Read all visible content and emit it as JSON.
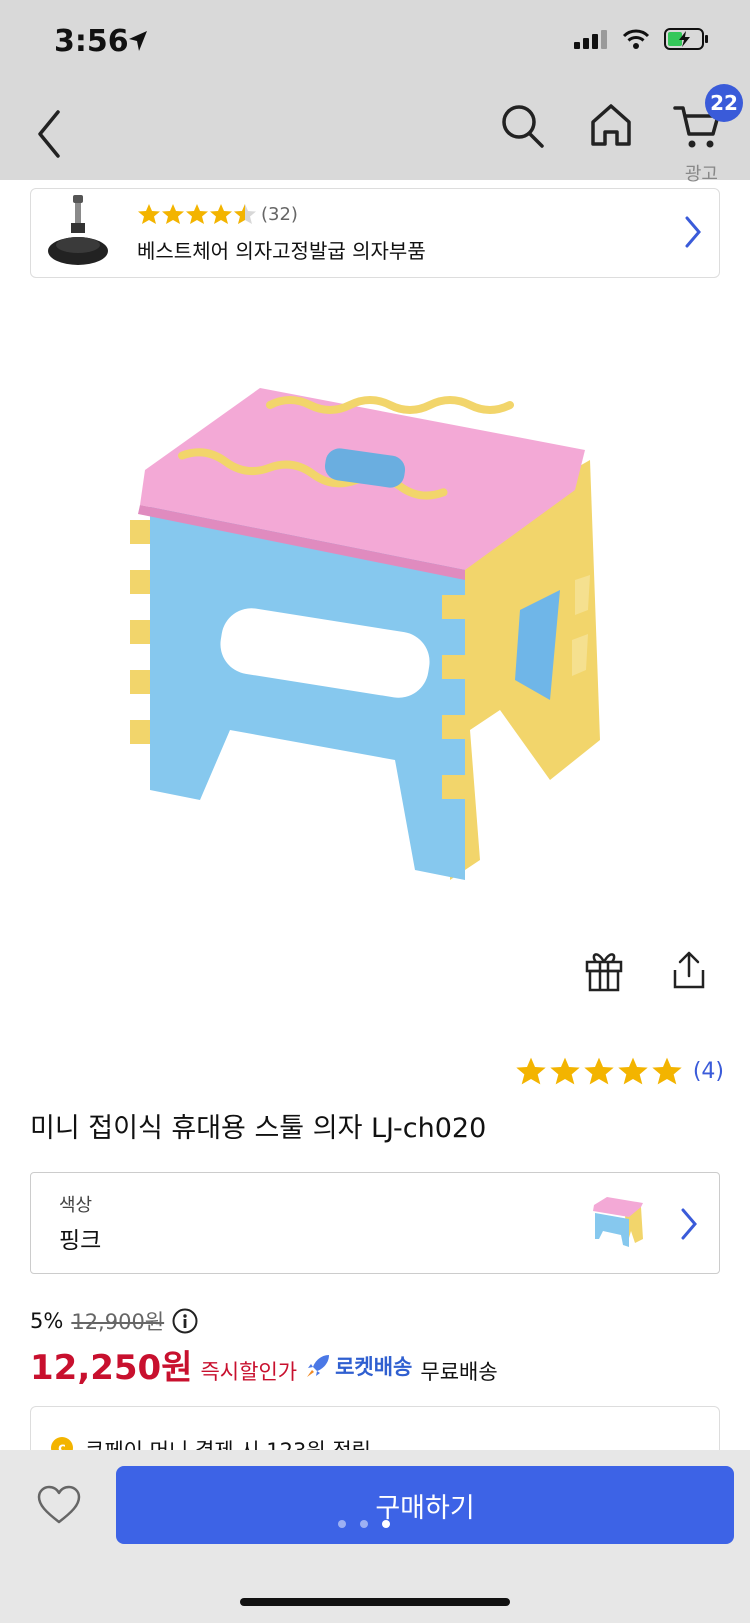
{
  "status_bar": {
    "time": "3:56"
  },
  "cart": {
    "badge_count": "22"
  },
  "ad": {
    "label": "광고",
    "rating": 4.5,
    "review_count": "(32)",
    "title": "베스트체어 의자고정발굽 의자부품"
  },
  "product": {
    "rating": 5,
    "review_count": "(4)",
    "title": "미니 접이식 휴대용 스툴 의자 LJ-ch020"
  },
  "option": {
    "label": "색상",
    "value": "핑크"
  },
  "pricing": {
    "discount": "5%",
    "original_price": "12,900원",
    "price": "12,250원",
    "instant_discount": "즉시할인가",
    "rocket": "로켓배송",
    "shipping": "무료배송"
  },
  "coupon": {
    "text": "쿠페이 머니 결제 시 123원 적립"
  },
  "bottom": {
    "buy_label": "구매하기"
  },
  "colors": {
    "accent": "#3d63e6",
    "price_red": "#c8102e",
    "star": "#f3b400"
  }
}
